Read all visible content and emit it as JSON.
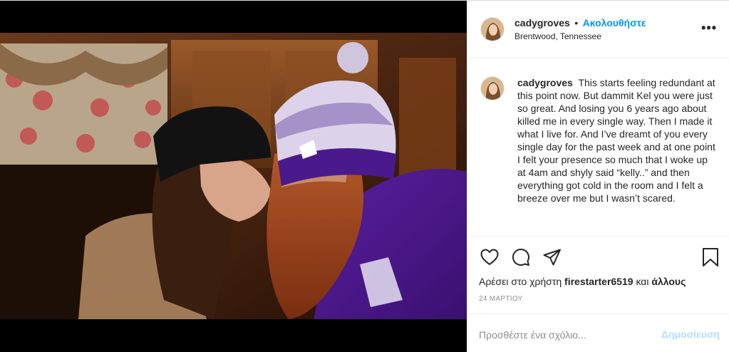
{
  "header": {
    "username": "cadygroves",
    "separator": "•",
    "follow_label": "Ακολουθήστε",
    "location": "Brentwood, Tennessee",
    "more_label": "•••"
  },
  "caption": {
    "username": "cadygroves",
    "text": "This starts feeling redundant at this point now. But dammit Kel you were just so great. And losing you 6 years ago about killed me in every single way. Then I made it what I live for. And I’ve dreamt of you every single day for the past week and at one point I felt your presence so much that I woke up at 4am and shyly said “kelly..” and then everything got cold in the room and I felt a breeze over me but I wasn’t scared."
  },
  "actions": {
    "icons": [
      "heart-icon",
      "comment-icon",
      "share-icon",
      "bookmark-icon"
    ]
  },
  "likes": {
    "prefix": "Αρέσει στο χρήστη",
    "user": "firestarter6519",
    "connector": "και",
    "others": "άλλους"
  },
  "date": "24 ΜΑΡΤΙΟΥ",
  "comment": {
    "placeholder": "Προσθέστε ένα σχόλιο...",
    "post_label": "Δημοσίευση"
  },
  "colors": {
    "accent": "#0095f6",
    "post_disabled": "#b2dffc",
    "muted": "#8e8e8e"
  }
}
